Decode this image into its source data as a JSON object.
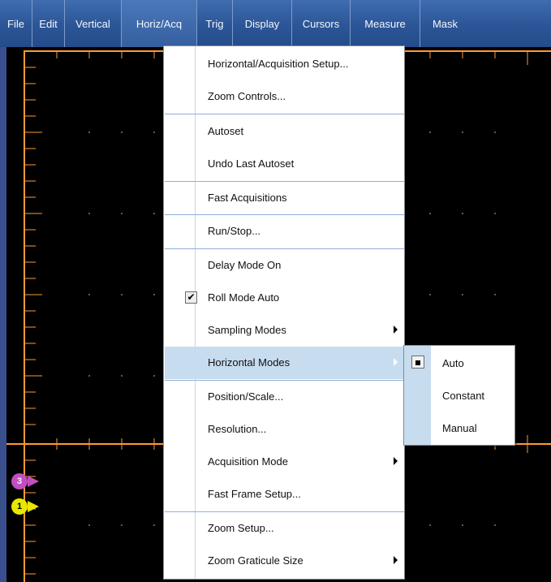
{
  "menubar": {
    "items": [
      {
        "label": "File"
      },
      {
        "label": "Edit"
      },
      {
        "label": "Vertical"
      },
      {
        "label": "Horiz/Acq"
      },
      {
        "label": "Trig"
      },
      {
        "label": "Display"
      },
      {
        "label": "Cursors"
      },
      {
        "label": "Measure"
      },
      {
        "label": "Mask"
      }
    ]
  },
  "dropdown": {
    "items": [
      {
        "label": "Horizontal/Acquisition Setup..."
      },
      {
        "label": "Zoom Controls..."
      },
      {
        "label": "Autoset"
      },
      {
        "label": "Undo Last Autoset"
      },
      {
        "label": "Fast Acquisitions"
      },
      {
        "label": "Run/Stop..."
      },
      {
        "label": "Delay Mode On"
      },
      {
        "label": "Roll Mode Auto",
        "checked": true
      },
      {
        "label": "Sampling Modes",
        "submenu": true
      },
      {
        "label": "Horizontal Modes",
        "submenu": true,
        "highlighted": true
      },
      {
        "label": "Position/Scale..."
      },
      {
        "label": "Resolution..."
      },
      {
        "label": "Acquisition Mode",
        "submenu": true
      },
      {
        "label": "Fast Frame Setup..."
      },
      {
        "label": "Zoom Setup..."
      },
      {
        "label": "Zoom Graticule Size",
        "submenu": true
      }
    ]
  },
  "submenu": {
    "items": [
      {
        "label": "Auto",
        "selected": true
      },
      {
        "label": "Constant"
      },
      {
        "label": "Manual"
      }
    ]
  },
  "markers": [
    {
      "label": "3",
      "color": "#c04fc0"
    },
    {
      "label": "1",
      "color": "#e8e800"
    }
  ],
  "colors": {
    "menubar": "#2b5597",
    "graticule": "#ff9933",
    "highlight": "#c7dcef"
  }
}
